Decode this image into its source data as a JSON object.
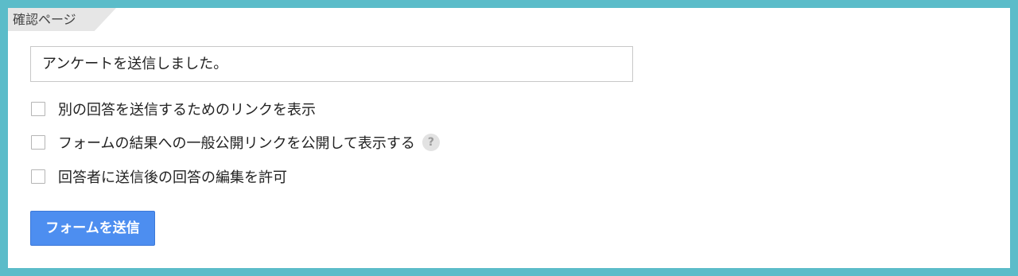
{
  "page_tab": {
    "label": "確認ページ"
  },
  "confirmation_message": {
    "value": "アンケートを送信しました。"
  },
  "options": [
    {
      "label": "別の回答を送信するためのリンクを表示",
      "checked": false
    },
    {
      "label": "フォームの結果への一般公開リンクを公開して表示する",
      "checked": false
    },
    {
      "label": "回答者に送信後の回答の編集を許可",
      "checked": false
    }
  ],
  "help_icon": {
    "glyph": "?",
    "icon": "help-icon"
  },
  "submit": {
    "label": "フォームを送信"
  },
  "colors": {
    "frame": "#5bbcc9",
    "button": "#4d8ef0",
    "tab": "#e6e6e6"
  }
}
